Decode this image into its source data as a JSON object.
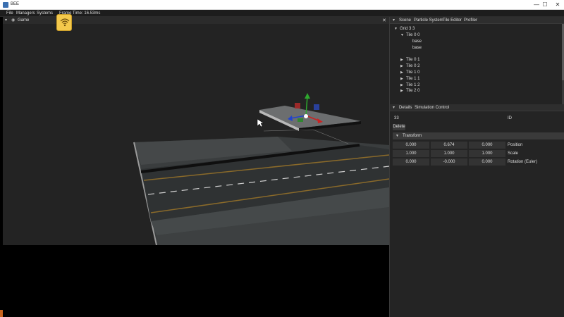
{
  "window": {
    "title": "BEE",
    "minimize_glyph": "—",
    "maximize_glyph": "☐",
    "close_glyph": "✕"
  },
  "menu": {
    "items": [
      "File",
      "Managers",
      "Systems"
    ],
    "frame_time": "Frame Time: 16.53ms"
  },
  "game_panel": {
    "title": "Game",
    "close_glyph": "✕"
  },
  "scene_tabs": [
    "Scene",
    "Particle System",
    "Tile Editor",
    "Profiler"
  ],
  "scene_tree": [
    {
      "label": "Grid 3 3",
      "arrow": "▼"
    },
    {
      "label": "Tile 0 0",
      "arrow": "▼"
    },
    {
      "label": "base",
      "arrow": ""
    },
    {
      "label": "base",
      "arrow": ""
    },
    {
      "label": "Tile 0 1",
      "arrow": "▶"
    },
    {
      "label": "Tile 0 2",
      "arrow": "▶"
    },
    {
      "label": "Tile 1 0",
      "arrow": "▶"
    },
    {
      "label": "Tile 1 1",
      "arrow": "▶"
    },
    {
      "label": "Tile 1 2",
      "arrow": "▶"
    },
    {
      "label": "Tile 2 0",
      "arrow": "▶"
    }
  ],
  "detail_tabs": [
    "Details",
    "Simulation Control"
  ],
  "details": {
    "id_value": "33",
    "id_label": "ID",
    "delete_label": "Delete",
    "transform_label": "Transform",
    "rows": [
      {
        "values": [
          "0.000",
          "0.674",
          "0.000"
        ],
        "label": "Position"
      },
      {
        "values": [
          "1.000",
          "1.000",
          "1.000"
        ],
        "label": "Scale"
      },
      {
        "values": [
          "0.000",
          "-0.000",
          "0.000"
        ],
        "label": "Rotation (Euler)"
      }
    ]
  },
  "icons": {
    "pin": "pin-icon",
    "eye": "eye-icon",
    "gizmo": "transform-gizmo-icon",
    "badge": "wifi-signal-icon"
  }
}
